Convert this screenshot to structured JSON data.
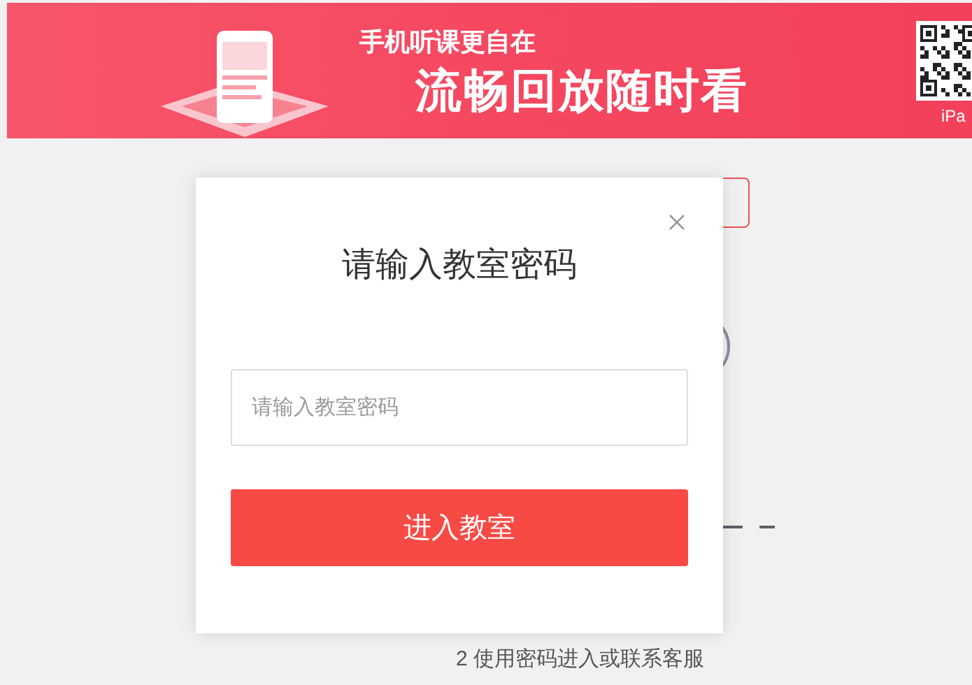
{
  "banner": {
    "headline": "手机听课更自在",
    "slogan": "流畅回放随时看",
    "qr_caption": "iPa"
  },
  "dialog": {
    "title": "请输入教室密码",
    "password_field": {
      "placeholder": "请输入教室密码"
    },
    "submit_button": "进入教室"
  },
  "background": {
    "hint": "2 使用密码进入或联系客服"
  }
}
